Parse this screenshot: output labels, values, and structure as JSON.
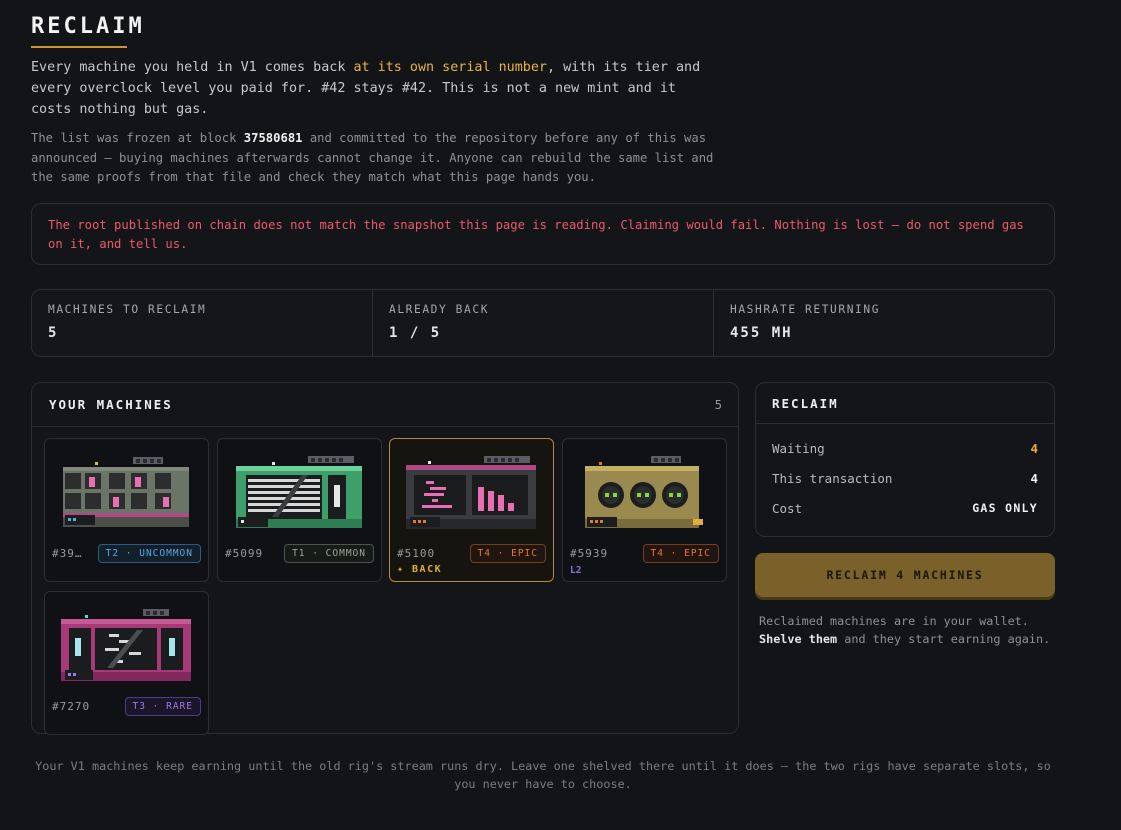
{
  "page": {
    "title": "RECLAIM",
    "intro_pre": "Every machine you held in V1 comes back ",
    "intro_highlight": "at its own serial number",
    "intro_post": ", with its tier and every overclock level you paid for. #42 stays #42. This is not a new mint and it costs nothing but gas.",
    "note_pre": "The list was frozen at block ",
    "note_block": "37580681",
    "note_post": " and committed to the repository before any of this was announced — buying machines afterwards cannot change it. Anyone can rebuild the same list and the same proofs from that file and check they match what this page hands you."
  },
  "alert": {
    "text": "The root published on chain does not match the snapshot this page is reading. Claiming would fail. Nothing is lost — do not spend gas on it, and tell us."
  },
  "stats": [
    {
      "label": "MACHINES TO RECLAIM",
      "value": "5"
    },
    {
      "label": "ALREADY BACK",
      "value": "1 / 5"
    },
    {
      "label": "HASHRATE RETURNING",
      "value": "455 MH"
    }
  ],
  "machines": {
    "title": "YOUR MACHINES",
    "count": "5",
    "items": [
      {
        "serial": "#39…",
        "tier": "T2 · UNCOMMON",
        "extra": ""
      },
      {
        "serial": "#5099",
        "tier": "T1 · COMMON",
        "extra": ""
      },
      {
        "serial": "#5100",
        "tier": "T4 · EPIC",
        "extra": "✦ BACK"
      },
      {
        "serial": "#5939",
        "tier": "T4 · EPIC",
        "extra": "L2"
      },
      {
        "serial": "#7270",
        "tier": "T3 · RARE",
        "extra": ""
      }
    ]
  },
  "reclaim": {
    "title": "RECLAIM",
    "rows": [
      {
        "label": "Waiting",
        "value": "4"
      },
      {
        "label": "This transaction",
        "value": "4"
      },
      {
        "label": "Cost",
        "value": "GAS ONLY"
      }
    ],
    "button": "RECLAIM 4 MACHINES",
    "note_line1": "Reclaimed machines are in your wallet.",
    "note_link": "Shelve them",
    "note_line2_post": " and they start earning again."
  },
  "footer": {
    "text": "Your V1 machines keep earning until the old rig's stream runs dry. Leave one shelved there until it does — the two rigs have separate slots, so you never have to choose."
  },
  "colors": {
    "accent": "#e2ad3c",
    "alert": "#ea5a6e",
    "button": "#7a6129",
    "background": "#131417"
  }
}
